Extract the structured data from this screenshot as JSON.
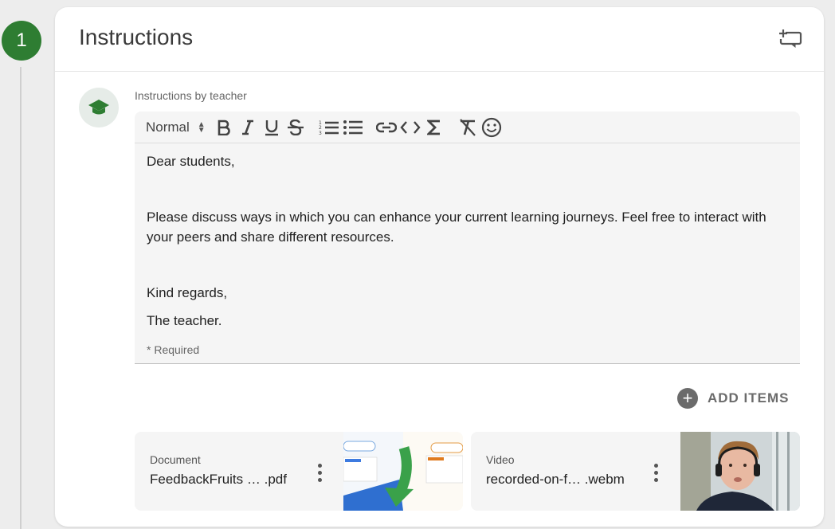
{
  "step": {
    "number": "1"
  },
  "card": {
    "title": "Instructions",
    "add_section_icon": "add-section-icon"
  },
  "teacher": {
    "label": "Instructions by teacher",
    "avatar_icon": "graduation-cap-icon",
    "accent_color": "#2e7d32"
  },
  "editor": {
    "toolbar": {
      "format_select": "Normal",
      "buttons": [
        "bold",
        "italic",
        "underline",
        "strikethrough",
        "ordered-list",
        "bullet-list",
        "link",
        "code",
        "formula",
        "clear-format",
        "emoji"
      ]
    },
    "paragraphs": [
      "Dear students,",
      "Please discuss ways in which you can enhance your current learning journeys. Feel free to interact with your peers and share different resources.",
      "Kind regards,",
      "The teacher."
    ],
    "required_note": "* Required"
  },
  "add_items": {
    "label": "ADD ITEMS"
  },
  "attachments": [
    {
      "kind": "Document",
      "name": "FeedbackFruits …  .pdf",
      "thumb": "pdf-preview"
    },
    {
      "kind": "Video",
      "name": "recorded-on-f…  .webm",
      "thumb": "video-preview"
    }
  ]
}
